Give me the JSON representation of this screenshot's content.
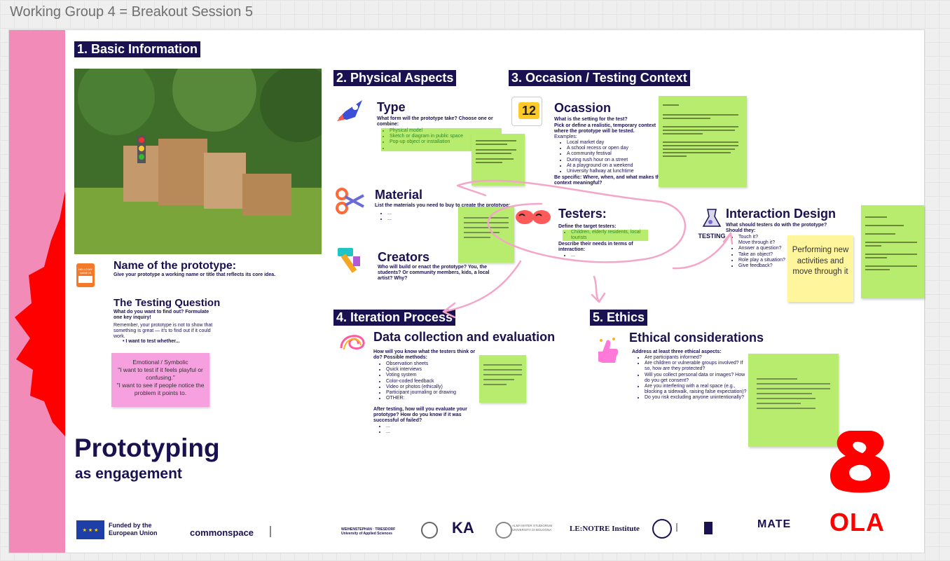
{
  "frame_title": "Working Group 4 = Breakout Session 5",
  "sections": {
    "basic": "1. Basic Information",
    "physical": "2. Physical Aspects",
    "occasion": "3. Occasion / Testing Context",
    "iteration": "4. Iteration Process",
    "ethics": "5. Ethics"
  },
  "name_block": {
    "title": "Name of the prototype:",
    "desc": "Give your prototype a working name or title that reflects its core idea.",
    "icon_text": "HELLO MY NAME IS"
  },
  "testing_question": {
    "title": "The Testing Question",
    "q": "What do you want to find out? Formulate one key inquiry!",
    "body": "Remember, your prototype is not to show that something is great — it's to find out if it could work.",
    "bullet": "I want to test whether..."
  },
  "pink_sticky": {
    "l1": "Emotional / Symbolic",
    "l2": "\"I want to test if it feels playful or confusing.\"",
    "l3": "\"I want to see if people notice the problem it points to."
  },
  "prototyping": {
    "big": "Prototyping",
    "small": "as engagement"
  },
  "type_block": {
    "title": "Type",
    "q": "What form will the prototype take? Choose one or combine:",
    "items": [
      "Physical model",
      "Sketch or diagram in public space",
      "Pop-up object or installation",
      ""
    ]
  },
  "material_block": {
    "title": "Material",
    "q": "List the materials you need to buy to create the prototype:",
    "items": [
      "...",
      "..."
    ]
  },
  "creators_block": {
    "title": "Creators",
    "q": "Who will build or enact the prototype? You, the students? Or community members, kids, a local artist? Why?"
  },
  "occasion_block": {
    "title": "Ocassion",
    "calendar_num": "12",
    "q1": "What is the setting for the test?",
    "q2": "Pick or define a realistic, temporary context where the prototype will be tested.",
    "examples_label": "Examples:",
    "items": [
      "Local market day",
      "A school recess or open day",
      "A community festival",
      "During rush hour on a street",
      "At a playground on a weekend",
      "University hallway at lunchtime"
    ],
    "footer": "Be specific: Where, when, and what makes this context meaningful?"
  },
  "testers_block": {
    "title": "Testers:",
    "q1": "Define the target testers:",
    "item": "Children, elderly residents, local tourists",
    "q2": "Describe their needs in terms of interaction:",
    "item2": "..."
  },
  "interaction_block": {
    "title": "Interaction Design",
    "icon_text": "TESTING",
    "q": "What should testers do with the prototype? Should they:",
    "items": [
      "Touch it?",
      "Move through it?",
      "Answer a question?",
      "Take an object?",
      "Role play a situation?",
      "Give feedback?"
    ]
  },
  "yellow_sticky": "Performing new activities and move through it",
  "data_block": {
    "title": "Data collection and evaluation",
    "q1": "How will you know what the testers think or do? Possible methods:",
    "items": [
      "Observation sheets",
      "Quick interviews",
      "Voting system",
      "Color-coded feedback",
      "Video or photos (ethically)",
      "Participant journaling or drawing",
      "OTHER:"
    ],
    "q2": "After testing, how will you evaluate your prototype? How do you know if it was successful of failed?",
    "items2": [
      "...",
      "..."
    ]
  },
  "ethics_block": {
    "title": "Ethical considerations",
    "q": "Address at least three ethical aspects:",
    "items": [
      "Are participants informed?",
      "Are children or vulnerable groups involved? If so, how are they protected?",
      "Will you collect personal data or images? How do you get consent?",
      "Are you interfering with a real space (e.g., blocking a sidewalk, raising false expectation)?",
      "Do you risk excluding anyone unintentionally?"
    ]
  },
  "logos": {
    "eu": "Funded by the European Union",
    "commonspace": "commonspace",
    "weihenstephan": "WEIHENSTEPHAN · TRIESDORF University of Applied Sciences",
    "ka": "KA",
    "bologna": "ALMA MATER STUDIORUM UNIVERSITÀ DI BOLOGNA",
    "lenotre": "LE:NOTRE Institute",
    "mate": "MATE",
    "ola": "OLA"
  },
  "colors": {
    "navy": "#1a1150",
    "pink": "#f28bb7",
    "red": "#ff0000",
    "sticky_green": "#b7ec6e",
    "sticky_yellow": "#fff59d",
    "sticky_pink": "#f6a0e0"
  }
}
